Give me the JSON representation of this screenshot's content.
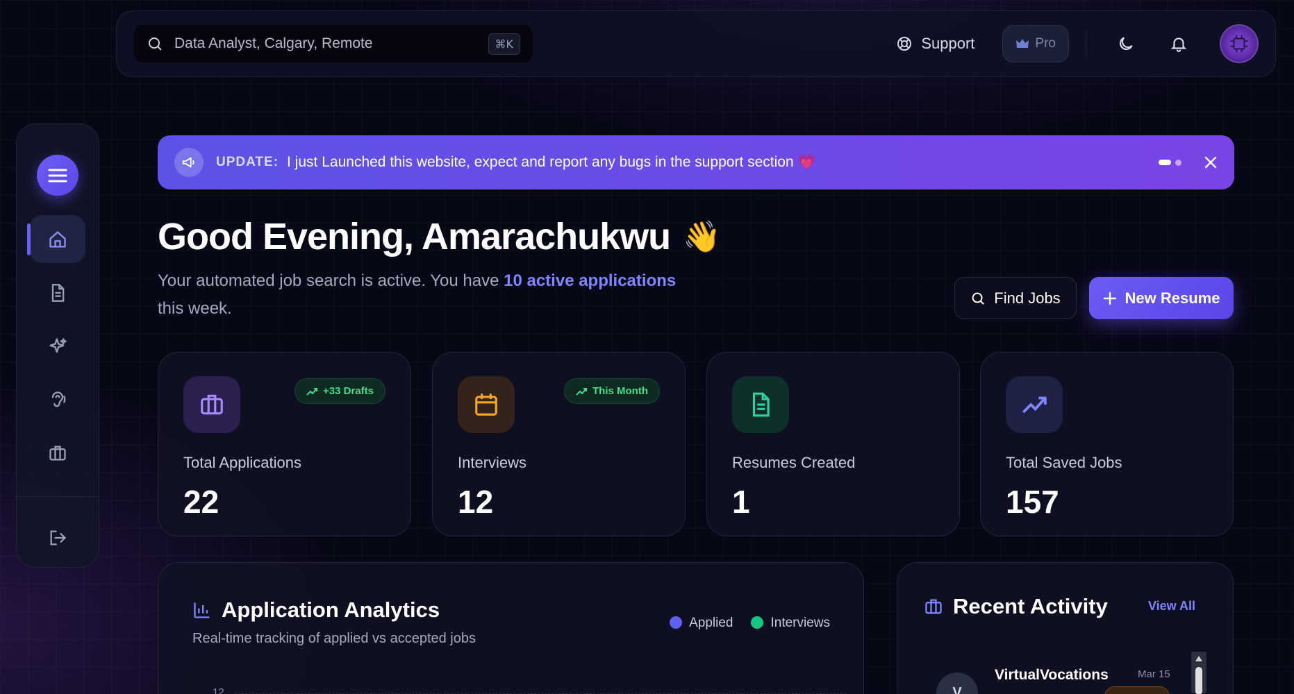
{
  "search": {
    "placeholder": "Data Analyst, Calgary, Remote",
    "shortcut": "⌘K"
  },
  "topbar": {
    "support_label": "Support",
    "pro_label": "Pro"
  },
  "banner": {
    "tag": "UPDATE:",
    "text": "I just Launched this website, expect and report any bugs in the support section 💗"
  },
  "greeting": {
    "title": "Good Evening, Amarachukwu",
    "emoji": "👋"
  },
  "subtitle": {
    "before": "Your automated job search is active. You have ",
    "highlight": "10 active applications",
    "after": " this week."
  },
  "actions": {
    "find_jobs": "Find Jobs",
    "new_resume": "New Resume"
  },
  "stats": [
    {
      "label": "Total Applications",
      "value": "22",
      "badge": "+33 Drafts",
      "icon": "briefcase-icon",
      "color": "#a58bff"
    },
    {
      "label": "Interviews",
      "value": "12",
      "badge": "This Month",
      "icon": "calendar-icon",
      "color": "#f5a623"
    },
    {
      "label": "Resumes Created",
      "value": "1",
      "badge": "",
      "icon": "document-icon",
      "color": "#2ed1a0"
    },
    {
      "label": "Total Saved Jobs",
      "value": "157",
      "badge": "",
      "icon": "trending-up-icon",
      "color": "#7f86ff"
    }
  ],
  "analytics": {
    "title": "Application Analytics",
    "subtitle": "Real-time tracking of applied vs accepted jobs",
    "legend": [
      {
        "name": "Applied",
        "color": "#6060f0"
      },
      {
        "name": "Interviews",
        "color": "#16c784"
      }
    ],
    "y_tick_top": "12"
  },
  "recent": {
    "title": "Recent Activity",
    "view_all": "View All",
    "items": [
      {
        "initial": "V",
        "company": "VirtualVocations",
        "date": "Mar 15"
      }
    ]
  },
  "colors": {
    "accent": "#6b5cf6",
    "background": "#070816"
  }
}
